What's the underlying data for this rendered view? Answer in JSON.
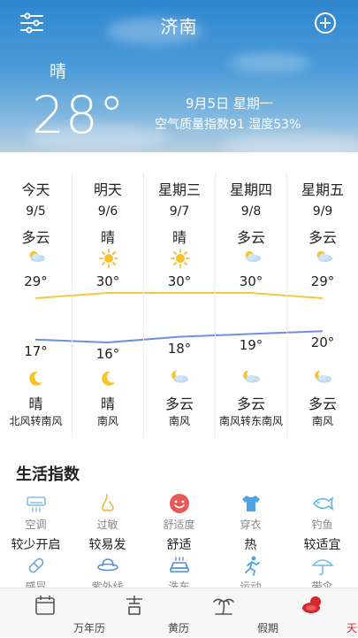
{
  "header": {
    "city": "济南",
    "condition": "晴",
    "temperature": "28°",
    "date": "9月5日 星期一",
    "air_humidity": "空气质量指数91  湿度53%"
  },
  "forecast": [
    {
      "day": "今天",
      "date": "9/5",
      "day_cond": "多云",
      "day_icon": "partly-cloudy-icon",
      "high": "29°",
      "low": "17°",
      "night_icon": "moon-icon",
      "night_cond": "晴",
      "wind": "北风转南风"
    },
    {
      "day": "明天",
      "date": "9/6",
      "day_cond": "晴",
      "day_icon": "sun-icon",
      "high": "30°",
      "low": "16°",
      "night_icon": "moon-icon",
      "night_cond": "晴",
      "wind": "南风"
    },
    {
      "day": "星期三",
      "date": "9/7",
      "day_cond": "晴",
      "day_icon": "sun-icon",
      "high": "30°",
      "low": "18°",
      "night_icon": "cloud-moon-icon",
      "night_cond": "多云",
      "wind": "南风"
    },
    {
      "day": "星期四",
      "date": "9/8",
      "day_cond": "多云",
      "day_icon": "partly-cloudy-icon",
      "high": "30°",
      "low": "19°",
      "night_icon": "cloud-moon-icon",
      "night_cond": "多云",
      "wind": "南风转东南风"
    },
    {
      "day": "星期五",
      "date": "9/9",
      "day_cond": "多云",
      "day_icon": "partly-cloudy-icon",
      "high": "29°",
      "low": "20°",
      "night_icon": "cloud-moon-icon",
      "night_cond": "多云",
      "wind": "南风"
    }
  ],
  "temps": {
    "high_values": [
      29,
      30,
      30,
      30,
      29
    ],
    "low_values": [
      17,
      16,
      18,
      19,
      20
    ],
    "high_color": "#f5c842",
    "low_color": "#6f8fe0"
  },
  "life": {
    "title": "生活指数",
    "items": [
      {
        "name": "空调",
        "value": "较少开启",
        "icon": "air-conditioner-icon",
        "color": "#7fbfe0"
      },
      {
        "name": "过敏",
        "value": "较易发",
        "icon": "nose-icon",
        "color": "#e6b84a"
      },
      {
        "name": "舒适度",
        "value": "舒适",
        "icon": "smiley-icon",
        "color": "#e85a5a"
      },
      {
        "name": "穿衣",
        "value": "热",
        "icon": "tshirt-icon",
        "color": "#4da3e6"
      },
      {
        "name": "钓鱼",
        "value": "较适宜",
        "icon": "fish-icon",
        "color": "#5ab4e6"
      },
      {
        "name": "感冒",
        "value": "",
        "icon": "pill-icon",
        "color": "#6fa8e0"
      },
      {
        "name": "紫外线",
        "value": "",
        "icon": "hat-icon",
        "color": "#5b8fd6"
      },
      {
        "name": "洗车",
        "value": "",
        "icon": "car-icon",
        "color": "#4f8fd6"
      },
      {
        "name": "运动",
        "value": "",
        "icon": "running-icon",
        "color": "#4da3e6"
      },
      {
        "name": "带伞",
        "value": "",
        "icon": "umbrella-icon",
        "color": "#6fbce6"
      }
    ]
  },
  "tabs": [
    {
      "label": "万年历",
      "icon": "calendar-icon",
      "active": false
    },
    {
      "label": "黄历",
      "icon": "ji-icon",
      "active": false
    },
    {
      "label": "假期",
      "icon": "palm-tree-icon",
      "active": false
    },
    {
      "label": "天气",
      "icon": "weather-icon",
      "active": true
    }
  ],
  "colors": {
    "accent": "#d8262e"
  }
}
